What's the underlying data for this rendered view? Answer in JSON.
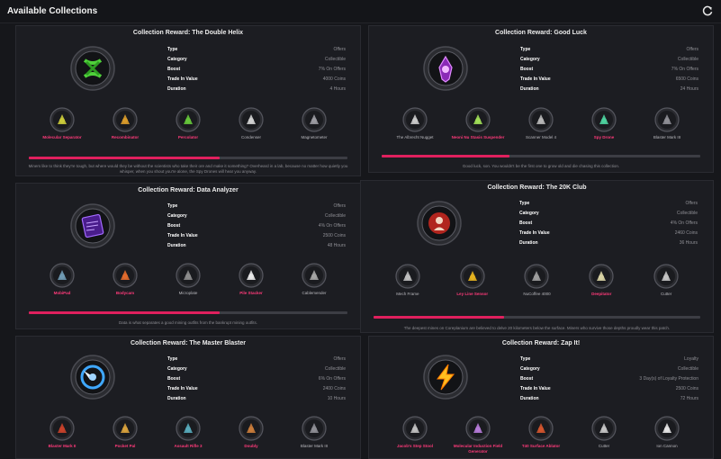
{
  "header": {
    "title": "Available Collections"
  },
  "icons": {
    "refresh": "refresh-icon"
  },
  "colors": {
    "accent": "#e0205e",
    "collected": "#ff3a7a"
  },
  "panels": [
    {
      "title": "Collection Reward: The Double Helix",
      "icon": "double-helix-icon",
      "stats": [
        {
          "key": "Type",
          "value": "Offers"
        },
        {
          "key": "Category",
          "value": "Collectible"
        },
        {
          "key": "Boost",
          "value": "7% On Offers"
        },
        {
          "key": "Trade In Value",
          "value": "4000 Coins"
        },
        {
          "key": "Duration",
          "value": "4 Hours"
        }
      ],
      "items": [
        {
          "label": "Molecular Separator",
          "collected": true,
          "icon": "molecular-separator-icon"
        },
        {
          "label": "Recombinator",
          "collected": true,
          "icon": "recombinator-icon"
        },
        {
          "label": "Percolator",
          "collected": true,
          "icon": "percolator-icon"
        },
        {
          "label": "Condenser",
          "collected": false,
          "icon": "condenser-icon"
        },
        {
          "label": "Magnetometer",
          "collected": false,
          "icon": "magnetometer-icon"
        }
      ],
      "progress": 0.6,
      "flavor": "Miners like to think they're tough, but where would they be without the scientists who take their ore and make it something? Overheard in a lab, because no matter how quietly you whisper, when you shout you're alone, the Spy Drones will hear you anyway."
    },
    {
      "title": "Collection Reward: Good Luck",
      "icon": "good-luck-icon",
      "stats": [
        {
          "key": "Type",
          "value": "Offers"
        },
        {
          "key": "Category",
          "value": "Collectible"
        },
        {
          "key": "Boost",
          "value": "7% On Offers"
        },
        {
          "key": "Trade In Value",
          "value": "6500 Coins"
        },
        {
          "key": "Duration",
          "value": "24 Hours"
        }
      ],
      "items": [
        {
          "label": "The Albrecht Nugget",
          "collected": false,
          "icon": "albrecht-nugget-icon"
        },
        {
          "label": "Neoni Nu Stasis Suspender",
          "collected": true,
          "icon": "stasis-suspender-icon"
        },
        {
          "label": "Scanner Model 4",
          "collected": false,
          "icon": "scanner-model-4-icon"
        },
        {
          "label": "Spy Drone",
          "collected": true,
          "icon": "spy-drone-icon"
        },
        {
          "label": "Blaster Mark III",
          "collected": false,
          "icon": "blaster-mark-iii-icon"
        }
      ],
      "progress": 0.4,
      "flavor": "Good luck, son. You wouldn't be the first one to grow old and die chasing this collection."
    },
    {
      "title": "Collection Reward: Data Analyzer",
      "icon": "data-analyzer-icon",
      "stats": [
        {
          "key": "Type",
          "value": "Offers"
        },
        {
          "key": "Category",
          "value": "Collectible"
        },
        {
          "key": "Boost",
          "value": "4% On Offers"
        },
        {
          "key": "Trade In Value",
          "value": "2500 Coins"
        },
        {
          "key": "Duration",
          "value": "48 Hours"
        }
      ],
      "items": [
        {
          "label": "MobiPad",
          "collected": true,
          "icon": "mobipad-icon"
        },
        {
          "label": "Bodycam",
          "collected": true,
          "icon": "bodycam-icon"
        },
        {
          "label": "Microplate",
          "collected": false,
          "icon": "microplate-icon"
        },
        {
          "label": "Pile Stacker",
          "collected": true,
          "icon": "pile-stacker-icon"
        },
        {
          "label": "Cablemender",
          "collected": false,
          "icon": "cablemender-icon"
        }
      ],
      "progress": 0.6,
      "flavor": "Data is what separates a good mining outfits from the bankrupt mining outfits."
    },
    {
      "title": "Collection Reward: The 20K Club",
      "icon": "20k-club-icon",
      "stats": [
        {
          "key": "Type",
          "value": "Offers"
        },
        {
          "key": "Category",
          "value": "Collectible"
        },
        {
          "key": "Boost",
          "value": "4% On Offers"
        },
        {
          "key": "Trade In Value",
          "value": "2460 Coins"
        },
        {
          "key": "Duration",
          "value": "36 Hours"
        }
      ],
      "items": [
        {
          "label": "Mech Frame",
          "collected": false,
          "icon": "mech-frame-icon"
        },
        {
          "label": "Ley Line Sensor",
          "collected": true,
          "icon": "ley-line-sensor-icon"
        },
        {
          "label": "NuCoffee 4000",
          "collected": false,
          "icon": "nucoffee-icon"
        },
        {
          "label": "Deepitator",
          "collected": true,
          "icon": "deepitator-icon"
        },
        {
          "label": "Cutter",
          "collected": false,
          "icon": "cutter-icon"
        }
      ],
      "progress": 0.4,
      "flavor": "The deepest mines on Coreplanium are believed to delve 20 kilometers below the surface. Miners who survive those depths proudly wear this patch."
    },
    {
      "title": "Collection Reward: The Master Blaster",
      "icon": "master-blaster-icon",
      "stats": [
        {
          "key": "Type",
          "value": "Offers"
        },
        {
          "key": "Category",
          "value": "Collectible"
        },
        {
          "key": "Boost",
          "value": "6% On Offers"
        },
        {
          "key": "Trade In Value",
          "value": "2400 Coins"
        },
        {
          "key": "Duration",
          "value": "10 Hours"
        }
      ],
      "items": [
        {
          "label": "Blaster Mark II",
          "collected": true,
          "icon": "blaster-mark-ii-icon"
        },
        {
          "label": "Pocket Pal",
          "collected": true,
          "icon": "pocket-pal-icon"
        },
        {
          "label": "Assault Rifle 3",
          "collected": true,
          "icon": "assault-rifle-icon"
        },
        {
          "label": "Doubly",
          "collected": true,
          "icon": "doubly-icon"
        },
        {
          "label": "Blaster Mark III",
          "collected": false,
          "icon": "blaster-mark-iii-icon"
        }
      ]
    },
    {
      "title": "Collection Reward: Zap It!",
      "icon": "zap-it-icon",
      "stats": [
        {
          "key": "Type",
          "value": "Loyalty"
        },
        {
          "key": "Category",
          "value": "Collectible"
        },
        {
          "key": "Boost",
          "value": "3 Day(s) of Loyalty Protection"
        },
        {
          "key": "Trade In Value",
          "value": "2500 Coins"
        },
        {
          "key": "Duration",
          "value": "72 Hours"
        }
      ],
      "items": [
        {
          "label": "Jacob's Step Stool",
          "collected": true,
          "icon": "step-stool-icon"
        },
        {
          "label": "Molecular Induction Field Generator",
          "collected": true,
          "icon": "induction-field-icon"
        },
        {
          "label": "T40 Surface Ablator",
          "collected": true,
          "icon": "surface-ablator-icon"
        },
        {
          "label": "Cutter",
          "collected": false,
          "icon": "cutter-icon"
        },
        {
          "label": "Ion Cannon",
          "collected": false,
          "icon": "ion-cannon-icon"
        }
      ]
    }
  ]
}
